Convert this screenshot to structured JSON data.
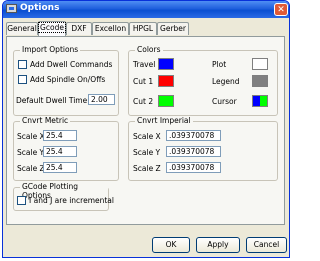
{
  "window": {
    "title": "Options",
    "close_glyph": "✕"
  },
  "tabs": [
    "General",
    "Gcode",
    "DXF",
    "Excellon",
    "HPGL",
    "Gerber"
  ],
  "import_options": {
    "title": "Import Options",
    "add_dwell_label": "Add Dwell Commands",
    "add_spindle_label": "Add Spindle On/Offs",
    "default_dwell_label": "Default Dwell Time",
    "default_dwell_value": "2.00"
  },
  "colors": {
    "title": "Colors",
    "travel_label": "Travel",
    "travel_color": "#0000ff",
    "plot_label": "Plot",
    "plot_color": "#ffffff",
    "cut1_label": "Cut 1",
    "cut1_color": "#ff0000",
    "legend_label": "Legend",
    "legend_color": "#808080",
    "cut2_label": "Cut 2",
    "cut2_color": "#00ff00",
    "cursor_label": "Cursor",
    "cursor_colors": [
      "#0000ff",
      "#00ff00"
    ]
  },
  "cnvrt_metric": {
    "title": "Cnvrt Metric",
    "rows": [
      {
        "label": "Scale X",
        "value": "25.4"
      },
      {
        "label": "Scale Y",
        "value": "25.4"
      },
      {
        "label": "Scale Z",
        "value": "25.4"
      }
    ]
  },
  "cnvrt_imperial": {
    "title": "Cnvrt Imperial",
    "rows": [
      {
        "label": "Scale X",
        "value": ".039370078"
      },
      {
        "label": "Scale Y",
        "value": ".039370078"
      },
      {
        "label": "Scale Z",
        "value": ".039370078"
      }
    ]
  },
  "gcode_plotting": {
    "title": "GCode Plotting Options",
    "ij_incremental_label": "I and J are incremental"
  },
  "buttons": {
    "ok": "OK",
    "apply": "Apply",
    "cancel": "Cancel"
  }
}
